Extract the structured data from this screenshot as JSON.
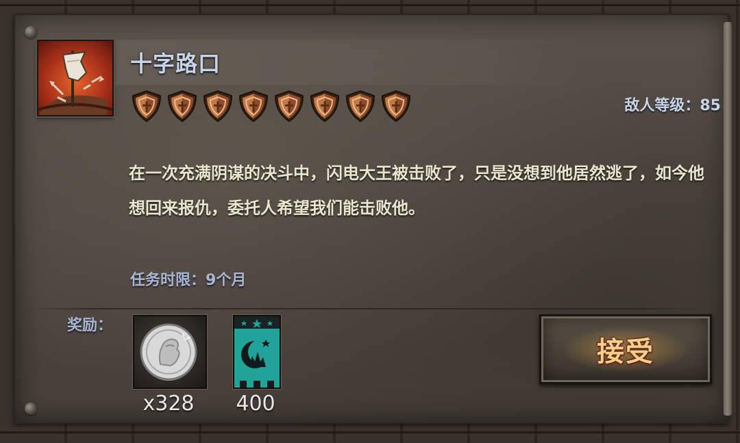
{
  "quest": {
    "title": "十字路口",
    "difficulty_shields": 8,
    "enemy_level_label": "敌人等级：",
    "enemy_level_value": "85",
    "description": "在一次充满阴谋的决斗中，闪电大王被击败了，只是没想到他居然逃了，如今他想回来报仇，委托人希望我们能击败他。",
    "time_limit_label": "任务时限：",
    "time_limit_value": "9个月"
  },
  "rewards": {
    "label": "奖励：",
    "items": [
      {
        "icon": "silver-coin-icon",
        "count": "x328"
      },
      {
        "icon": "moon-banner-icon",
        "count": "400"
      }
    ]
  },
  "accept_button": {
    "label": "接受"
  },
  "colors": {
    "title": "#c9d3e6",
    "description": "#e8e6cf",
    "accept_text": "#f6cf86",
    "banner_teal": "#21a39a",
    "shield_copper": "#b86a3c"
  }
}
